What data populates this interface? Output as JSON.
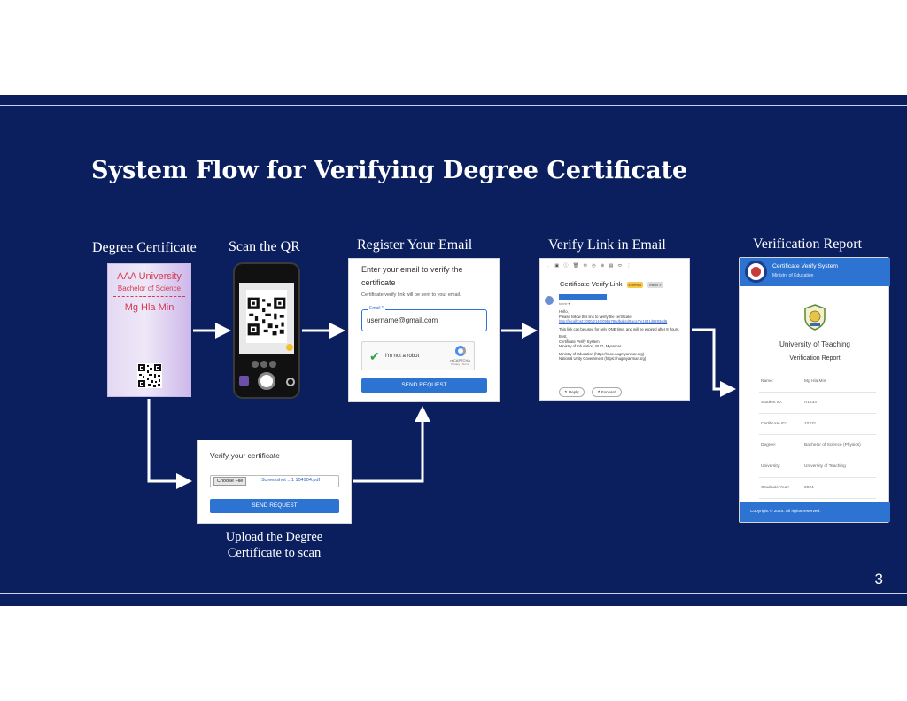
{
  "slide": {
    "title": "System Flow for Verifying Degree Certificate",
    "page_number": "3",
    "colors": {
      "background": "#0b1f5e",
      "accent": "#2c73d2",
      "certificate_text": "#d33b4f"
    }
  },
  "labels": {
    "degree_certificate": "Degree Certificate",
    "scan_qr": "Scan the QR",
    "register_email": "Register Your Email",
    "verify_link": "Verify Link in Email",
    "verification_report": "Verification Report",
    "upload_line1": "Upload the Degree",
    "upload_line2": "Certificate to scan"
  },
  "certificate": {
    "university": "AAA University",
    "degree": "Bachelor of Science",
    "name": "Mg Hla Min",
    "icon": "qr-code-icon"
  },
  "register": {
    "heading": "Enter your email to verify the certificate",
    "subtext": "Certificate verify link will be sent to your email.",
    "email_label": "Email *",
    "email_value": "username@gmail.com",
    "captcha_label": "I'm not a robot",
    "captcha_brand": "reCAPTCHA",
    "captcha_links": "Privacy - Terms",
    "button": "SEND REQUEST"
  },
  "email": {
    "subject": "Certificate Verify Link",
    "tag_external": "External",
    "tag_inbox": "Inbox ×",
    "to": "to me ▾",
    "greeting": "Hello,",
    "line1": "Please follow this link to verify the certificate",
    "link": "http://localhost:3000/2140/09b5786dbab1d5aca7fe1541d6283ed6",
    "line2": "This link can be used for only ONE time, and will be expired after 8 hours.",
    "best": "Best,",
    "sig1": "Certificate Verify System",
    "sig2": "Ministry of Education, NUG, Myanmar",
    "moe_line": "Ministry of Education (https://moe.nugmyanmar.org)",
    "nug_line": "National Unity Government (https://nugmyanmar.org)",
    "reply": "↰ Reply",
    "forward": "↱ Forward"
  },
  "upload": {
    "heading": "Verify your certificate",
    "choose_file": "Choose File",
    "file_name": "Screenshot ...1 104904.pdf",
    "button": "SEND REQUEST"
  },
  "report": {
    "system_title": "Certificate Verify System",
    "ministry": "Ministry of Education",
    "university": "University of Teaching",
    "report_title": "Verification Report",
    "rows": [
      {
        "label": "Name:",
        "value": "Mg Hla Min"
      },
      {
        "label": "Student ID:",
        "value": "A1234"
      },
      {
        "label": "Certificate ID:",
        "value": "10231"
      },
      {
        "label": "Degree:",
        "value": "Bachelor of Science (Physics)"
      },
      {
        "label": "University:",
        "value": "University of Teaching"
      },
      {
        "label": "Graduate Year:",
        "value": "2024"
      }
    ],
    "copyright": "Copyright © 2024. All rights reserved."
  }
}
